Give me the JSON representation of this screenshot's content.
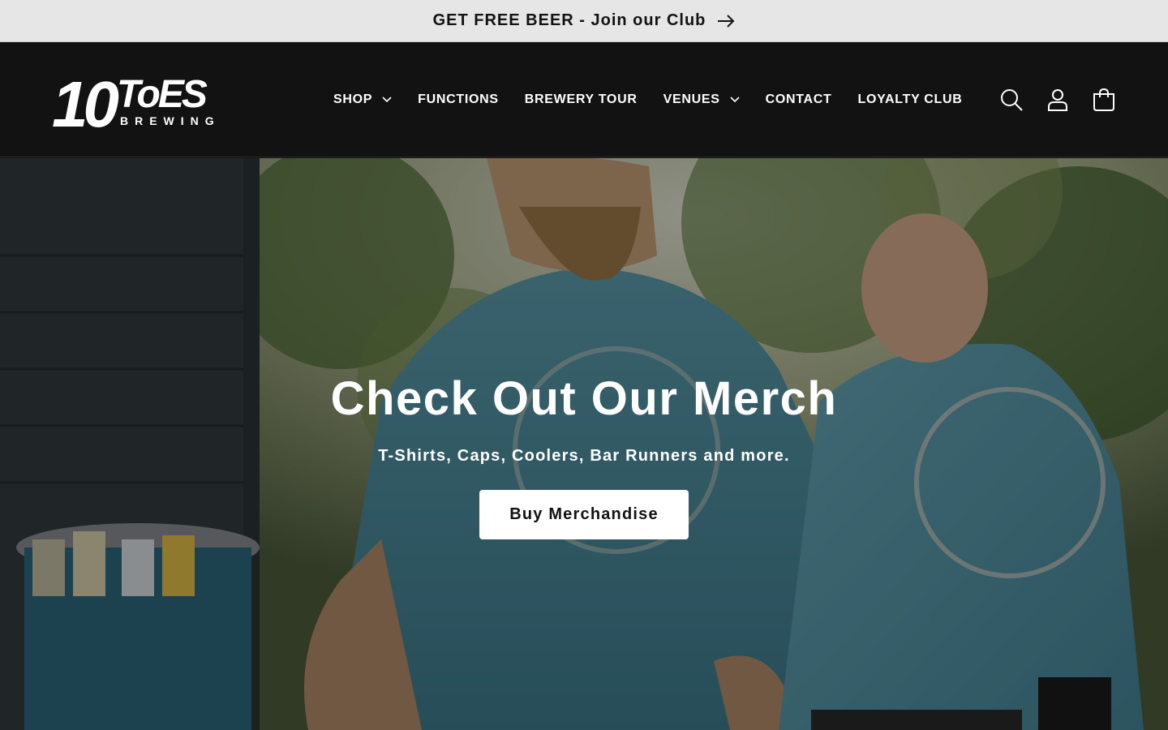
{
  "announcement": {
    "text": "GET FREE BEER - Join our Club",
    "icon": "arrow-right-icon"
  },
  "header": {
    "logo": {
      "main": "10 ToES",
      "sub": "BREWING"
    },
    "nav": [
      {
        "label": "SHOP",
        "has_dropdown": true
      },
      {
        "label": "FUNCTIONS",
        "has_dropdown": false
      },
      {
        "label": "BREWERY TOUR",
        "has_dropdown": false
      },
      {
        "label": "VENUES",
        "has_dropdown": true
      },
      {
        "label": "CONTACT",
        "has_dropdown": false
      },
      {
        "label": "LOYALTY CLUB",
        "has_dropdown": false
      }
    ],
    "icons": [
      "search-icon",
      "account-icon",
      "cart-icon"
    ]
  },
  "hero": {
    "title": "Check Out Our Merch",
    "subtitle": "T-Shirts, Caps, Coolers, Bar Runners and more.",
    "button_label": "Buy Merchandise"
  },
  "colors": {
    "announcement_bg": "#e6e6e6",
    "header_bg": "#121212",
    "text_light": "#ffffff",
    "text_dark": "#121212",
    "shirt_blue": "#4d8ea0"
  }
}
